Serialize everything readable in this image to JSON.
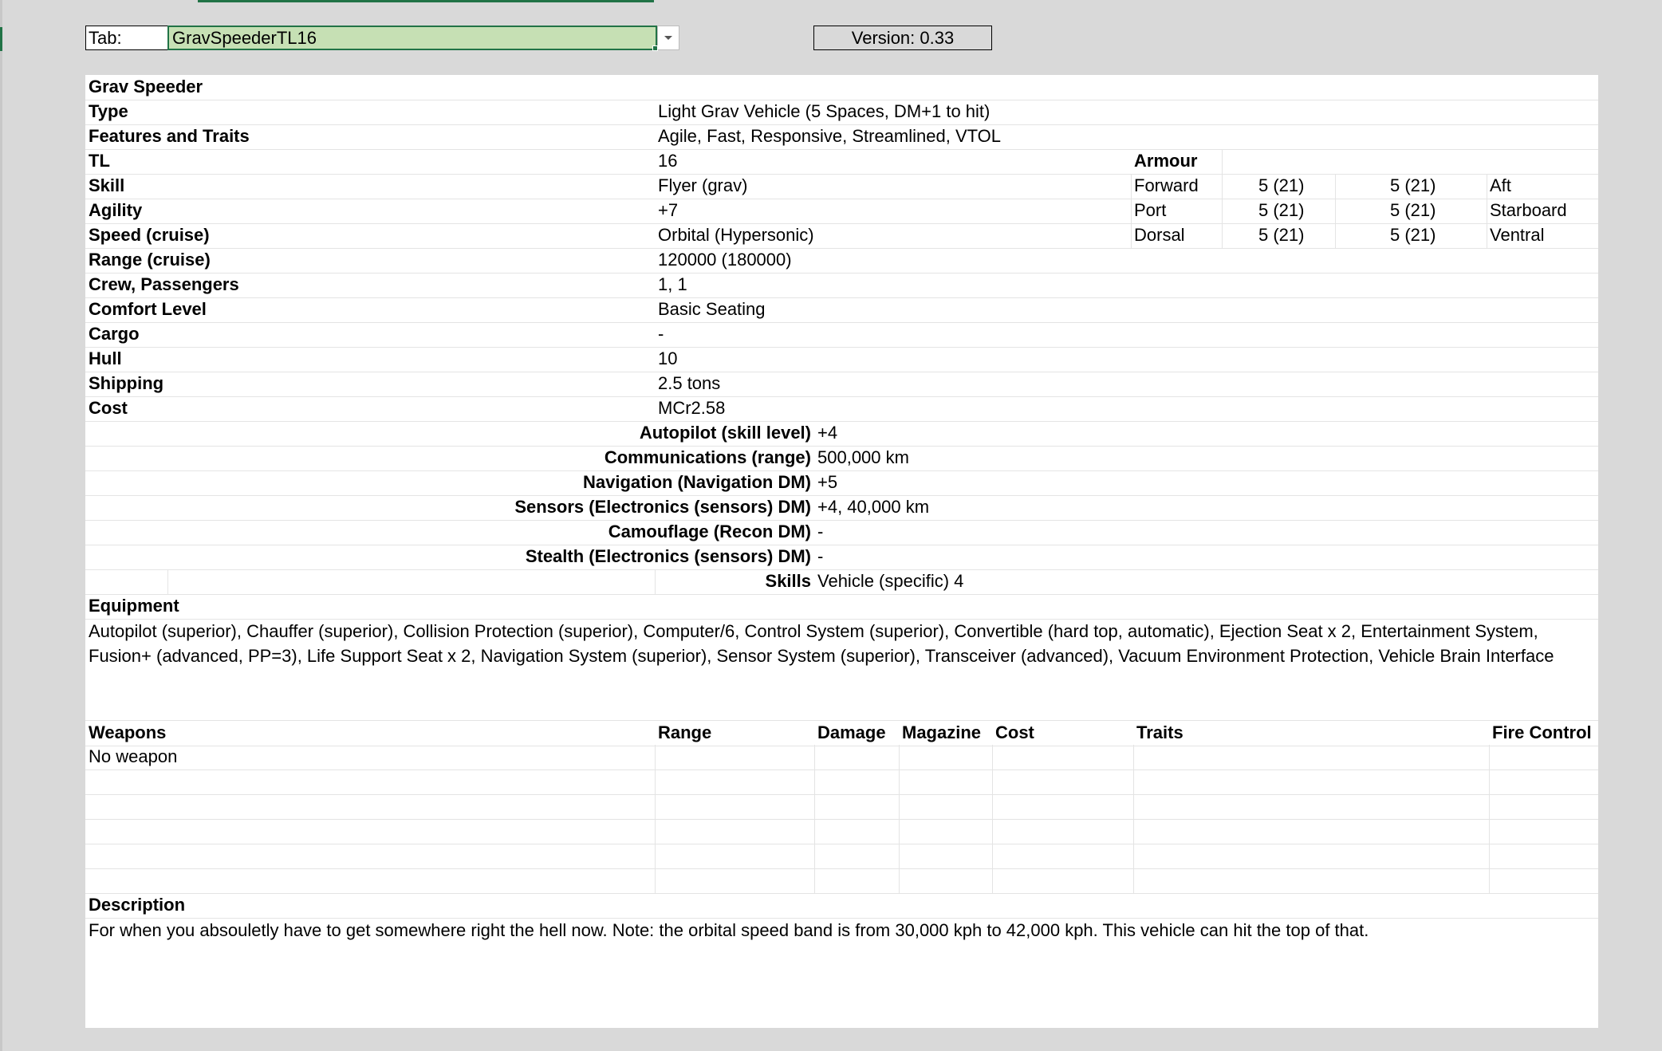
{
  "toolbar": {
    "tab_label": "Tab:",
    "tab_value": "GravSpeederTL16",
    "version": "Version: 0.33"
  },
  "vehicle": {
    "name": "Grav Speeder",
    "stats": [
      {
        "label": "Type",
        "value": "Light Grav Vehicle (5 Spaces, DM+1 to hit)"
      },
      {
        "label": "Features and Traits",
        "value": "Agile, Fast, Responsive, Streamlined, VTOL"
      },
      {
        "label": "TL",
        "value": "16"
      },
      {
        "label": "Skill",
        "value": "Flyer (grav)"
      },
      {
        "label": "Agility",
        "value": "+7"
      },
      {
        "label": "Speed (cruise)",
        "value": "Orbital (Hypersonic)"
      },
      {
        "label": "Range (cruise)",
        "value": "120000 (180000)"
      },
      {
        "label": "Crew, Passengers",
        "value": "1, 1"
      },
      {
        "label": "Comfort Level",
        "value": "Basic Seating"
      },
      {
        "label": "Cargo",
        "value": "-"
      },
      {
        "label": "Hull",
        "value": "10"
      },
      {
        "label": "Shipping",
        "value": "2.5 tons"
      },
      {
        "label": "Cost",
        "value": "MCr2.58"
      }
    ]
  },
  "armour": {
    "title": "Armour",
    "rows": [
      {
        "face_a": "Forward",
        "val_a": "5 (21)",
        "val_b": "5 (21)",
        "face_b": "Aft"
      },
      {
        "face_a": "Port",
        "val_a": "5 (21)",
        "val_b": "5 (21)",
        "face_b": "Starboard"
      },
      {
        "face_a": "Dorsal",
        "val_a": "5 (21)",
        "val_b": "5 (21)",
        "face_b": "Ventral"
      }
    ]
  },
  "systems": [
    {
      "label": "Autopilot (skill level)",
      "value": "+4"
    },
    {
      "label": "Communications (range)",
      "value": "500,000 km"
    },
    {
      "label": "Navigation (Navigation DM)",
      "value": "+5"
    },
    {
      "label": "Sensors (Electronics (sensors) DM)",
      "value": "+4, 40,000 km"
    },
    {
      "label": "Camouflage (Recon DM)",
      "value": "-"
    },
    {
      "label": "Stealth (Electronics (sensors) DM)",
      "value": "-"
    },
    {
      "label": "Skills",
      "value": "Vehicle (specific) 4"
    }
  ],
  "equipment": {
    "title": "Equipment",
    "text": "Autopilot (superior), Chauffer (superior), Collision Protection (superior), Computer/6, Control System (superior), Convertible (hard top, automatic), Ejection Seat x 2, Entertainment System, Fusion+ (advanced, PP=3), Life Support Seat x 2, Navigation System (superior), Sensor System (superior), Transceiver (advanced), Vacuum Environment Protection, Vehicle Brain Interface"
  },
  "weapons": {
    "headers": [
      "Weapons",
      "Range",
      "Damage",
      "Magazine",
      "Cost",
      "Traits",
      "Fire Control"
    ],
    "rows": [
      [
        "No weapon",
        "",
        "",
        "",
        "",
        "",
        ""
      ]
    ]
  },
  "description": {
    "title": "Description",
    "text": "For when you absouletly have to get somewhere right the hell now. Note: the orbital speed band is from 30,000 kph to 42,000 kph. This vehicle can hit the top of that."
  },
  "icons": {
    "dropdown": "chevron-down-icon"
  }
}
